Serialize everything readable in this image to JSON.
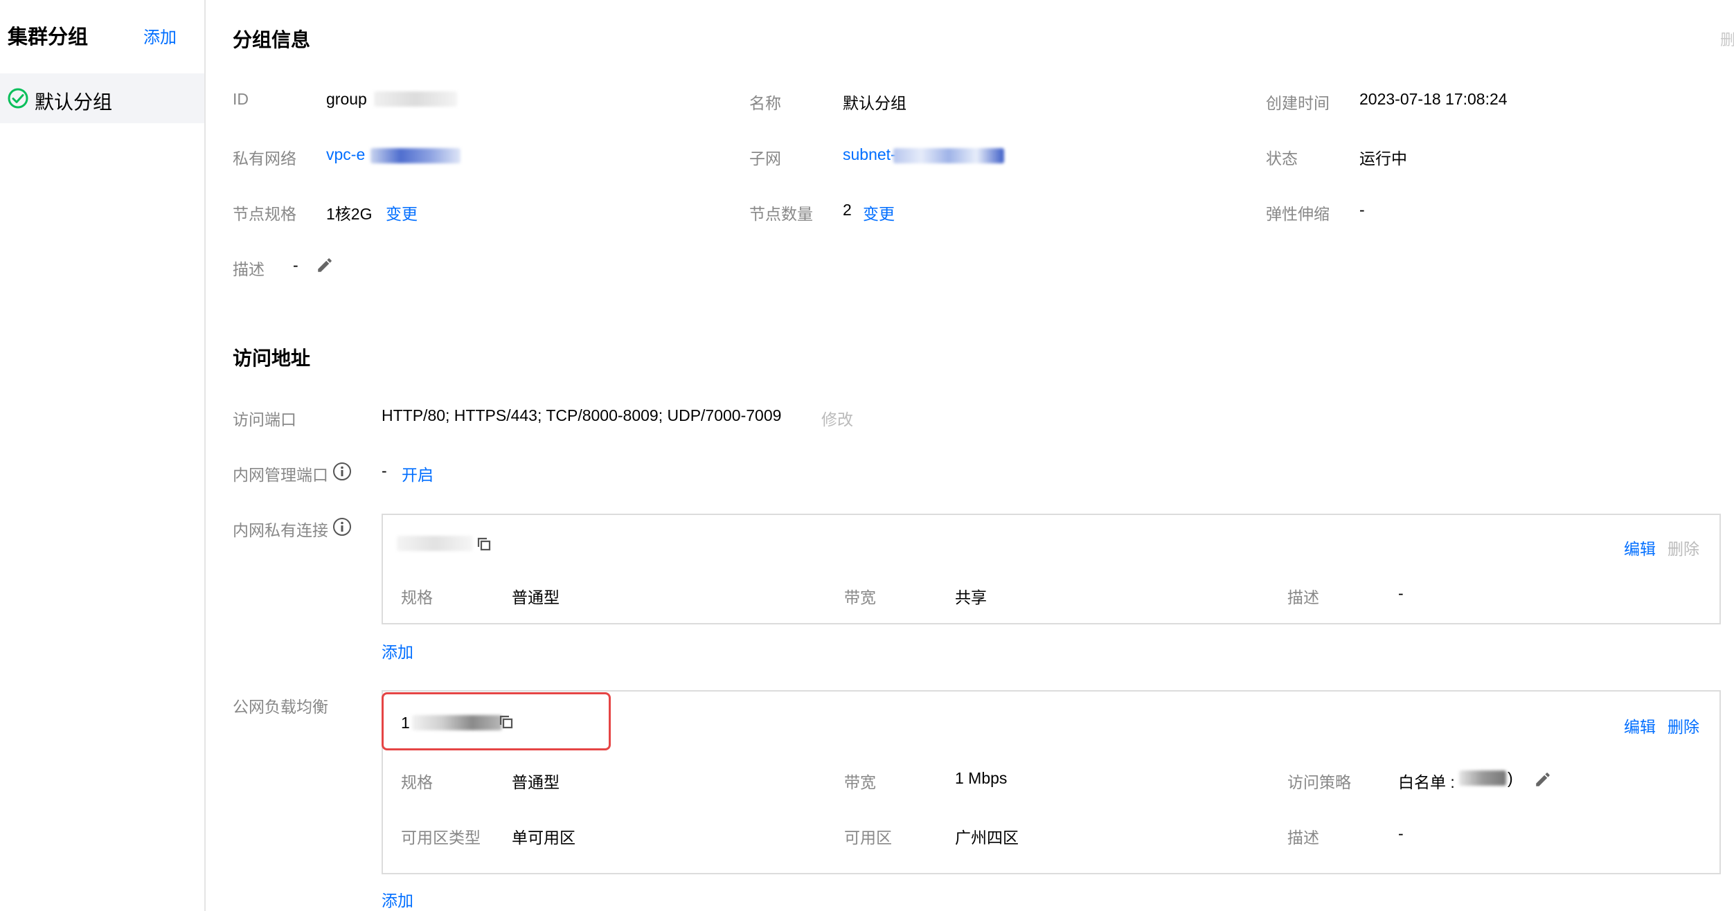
{
  "sidebar": {
    "title": "集群分组",
    "add_label": "添加",
    "items": [
      {
        "label": "默认分组",
        "status": "selected"
      }
    ]
  },
  "group_info": {
    "title": "分组信息",
    "top_right_text": "删",
    "id_label": "ID",
    "id_value": "group",
    "name_label": "名称",
    "name_value": "默认分组",
    "created_label": "创建时间",
    "created_value": "2023-07-18 17:08:24",
    "vpc_label": "私有网络",
    "vpc_value": "vpc-e",
    "subnet_label": "子网",
    "subnet_value": "subnet-",
    "status_label": "状态",
    "status_value": "运行中",
    "spec_label": "节点规格",
    "spec_value": "1核2G",
    "spec_change": "变更",
    "count_label": "节点数量",
    "count_value": "2",
    "count_change": "变更",
    "elastic_label": "弹性伸缩",
    "elastic_value": "-",
    "desc_label": "描述",
    "desc_value": "-"
  },
  "access": {
    "title": "访问地址",
    "port_label": "访问端口",
    "port_value": "HTTP/80; HTTPS/443; TCP/8000-8009; UDP/7000-7009",
    "port_modify": "修改",
    "mgmt_label": "内网管理端口",
    "mgmt_value": "-",
    "mgmt_enable": "开启",
    "private_label": "内网私有连接",
    "private_card": {
      "edit": "编辑",
      "delete": "删除",
      "spec_label": "规格",
      "spec_value": "普通型",
      "bw_label": "带宽",
      "bw_value": "共享",
      "desc_label": "描述",
      "desc_value": "-"
    },
    "private_add": "添加",
    "public_label": "公网负载均衡",
    "public_card": {
      "address_prefix": "1",
      "edit": "编辑",
      "delete": "删除",
      "spec_label": "规格",
      "spec_value": "普通型",
      "bw_label": "带宽",
      "bw_value": "1 Mbps",
      "policy_label": "访问策略",
      "policy_value": "白名单 :",
      "policy_suffix": ")",
      "zone_type_label": "可用区类型",
      "zone_type_value": "单可用区",
      "zone_label": "可用区",
      "zone_value": "广州四区",
      "desc_label": "描述",
      "desc_value": "-"
    },
    "public_add": "添加"
  },
  "colors": {
    "link": "#006eff",
    "label": "#888888",
    "highlight": "#e54545",
    "success": "#0abf5b"
  }
}
